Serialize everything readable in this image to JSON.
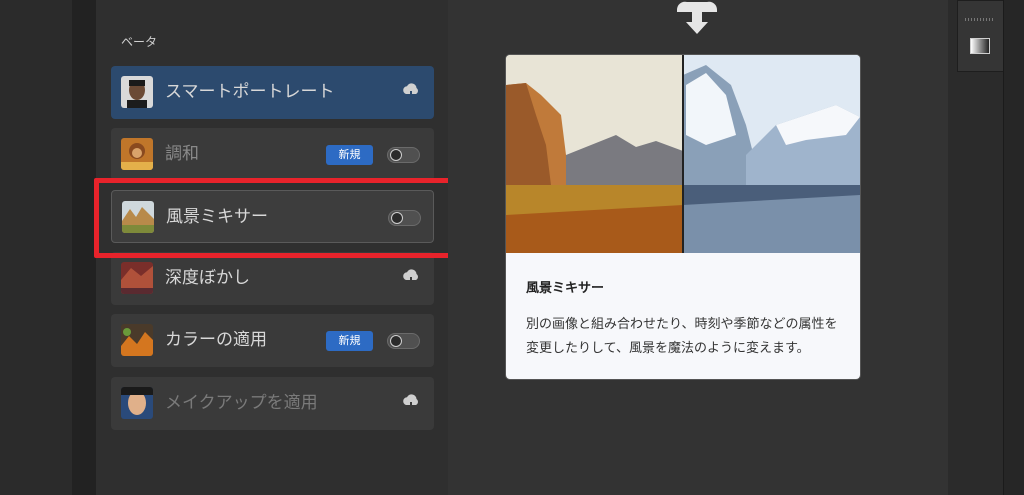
{
  "section": {
    "label": "ベータ"
  },
  "filters": [
    {
      "label": "スマートポートレート",
      "state": "active",
      "control": "cloud-download"
    },
    {
      "label": "調和",
      "badge": "新規",
      "control": "toggle"
    },
    {
      "label": "風景ミキサー",
      "state": "selected",
      "control": "toggle"
    },
    {
      "label": "深度ぼかし",
      "control": "cloud-download"
    },
    {
      "label": "カラーの適用",
      "badge": "新規",
      "control": "toggle"
    },
    {
      "label": "メイクアップを適用",
      "state": "disabled",
      "control": "cloud-download"
    }
  ],
  "preview": {
    "title": "風景ミキサー",
    "description": "別の画像と組み合わせたり、時刻や季節などの属性を変更したりして、風景を魔法のように変えます。"
  },
  "colors": {
    "accent": "#2d6bc4",
    "highlight": "#e8232b",
    "active_bg": "#2c4a6e"
  }
}
